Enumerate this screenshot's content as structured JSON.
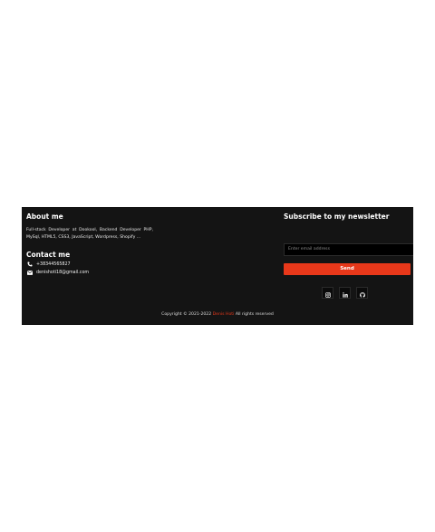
{
  "about": {
    "title": "About me",
    "text": "Full-stack Developer at Dookool, Backend Developer PHP, MySql, HTML5, CSS3, JavaScript, Wordpress, Shopify ..."
  },
  "contact": {
    "title": "Contact me",
    "phone": "+38344565827",
    "email": "denishoti18@gmail.com"
  },
  "newsletter": {
    "title": "Subscribe to my newsletter",
    "email_placeholder": "Enter email address",
    "send_label": "Send"
  },
  "socials": [
    {
      "name": "instagram",
      "icon": "instagram-icon"
    },
    {
      "name": "linkedin",
      "icon": "linkedin-icon"
    },
    {
      "name": "github",
      "icon": "github-icon"
    }
  ],
  "footer": {
    "copyright_prefix": "Copyright © 2021-2022 ",
    "author": "Denis Hoti",
    "copyright_suffix": " All rights reserved"
  },
  "colors": {
    "background": "#141414",
    "accent": "#e8381a"
  }
}
